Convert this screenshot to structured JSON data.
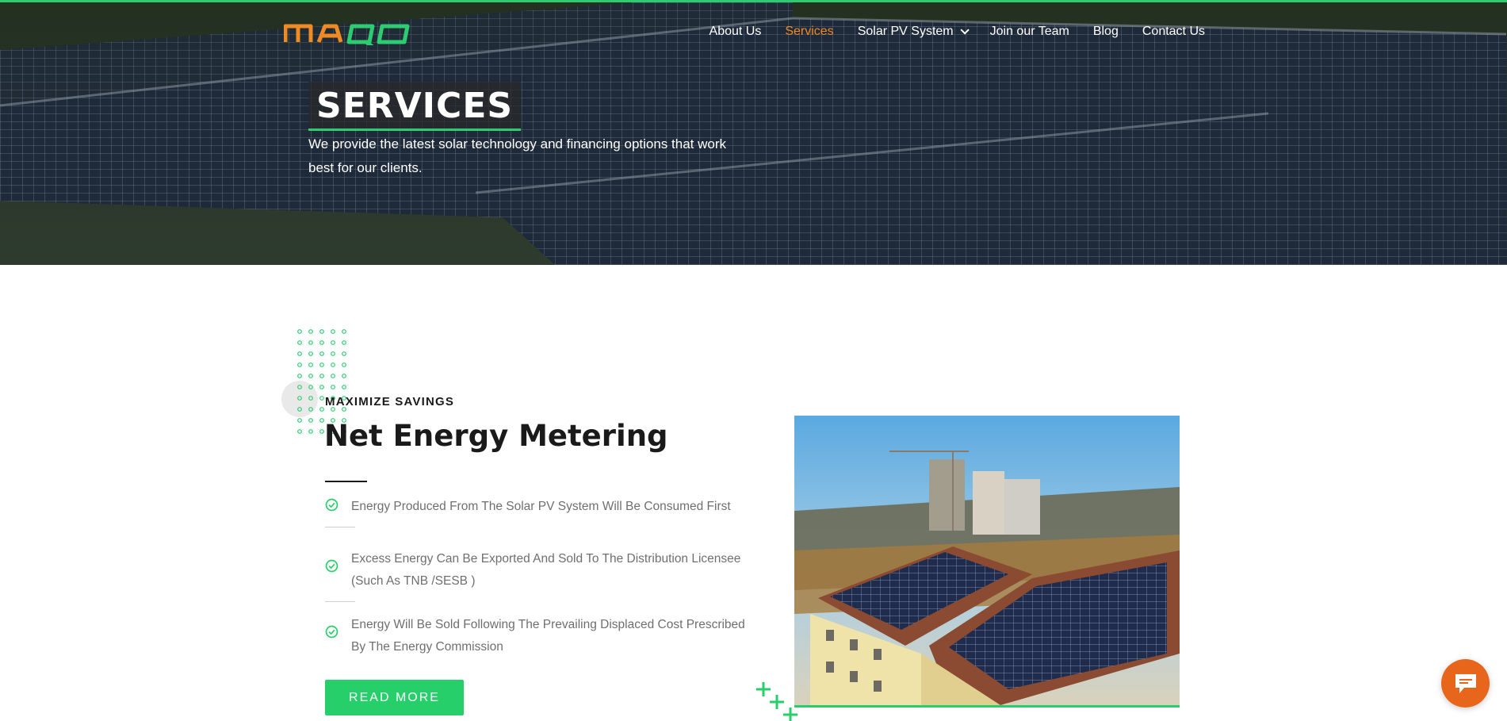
{
  "brand": {
    "logo_text": "MAQO",
    "logo_color_left": "#f08a24",
    "logo_color_right": "#2ecc71"
  },
  "nav": {
    "items": [
      {
        "label": "About Us"
      },
      {
        "label": "Services",
        "active": true
      },
      {
        "label": "Solar PV System",
        "has_dropdown": true
      },
      {
        "label": "Join our Team"
      },
      {
        "label": "Blog"
      },
      {
        "label": "Contact Us"
      }
    ]
  },
  "hero": {
    "title": "SERVICES",
    "subtitle": "We provide the latest solar technology and financing options that work best for our clients."
  },
  "section": {
    "eyebrow": "MAXIMIZE SAVINGS",
    "heading": "Net Energy Metering",
    "features": [
      "Energy Produced From The Solar PV System Will Be Consumed First",
      "Excess Energy Can Be Exported And Sold To The Distribution Licensee (Such As TNB /SESB )",
      "Energy Will Be Sold Following The Prevailing Displaced Cost Prescribed By The Energy Commission"
    ],
    "button_label": "READ MORE"
  },
  "icons": {
    "feature_icon": "check-circle-icon",
    "chat_icon": "chat-bubble-icon"
  },
  "colors": {
    "accent_green": "#27cf6a",
    "accent_orange": "#f08a24",
    "chat_orange": "#e8661b"
  }
}
